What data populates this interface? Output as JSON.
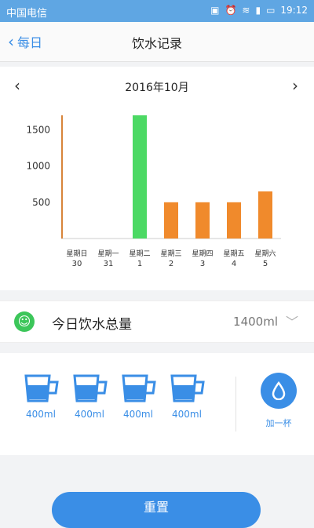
{
  "status_bar": {
    "carrier": "中国电信",
    "time": "19:12"
  },
  "nav": {
    "back_label": "每日",
    "title": "饮水记录"
  },
  "month": {
    "label": "2016年10月"
  },
  "chart_data": {
    "type": "bar",
    "categories": [
      "星期日 30",
      "星期一 31",
      "星期二 1",
      "星期三 2",
      "星期四 3",
      "星期五 4",
      "星期六 5"
    ],
    "day_names": [
      "星期日",
      "星期一",
      "星期二",
      "星期三",
      "星期四",
      "星期五",
      "星期六"
    ],
    "day_dates": [
      "30",
      "31",
      "1",
      "2",
      "3",
      "4",
      "5"
    ],
    "values": [
      1700,
      0,
      1700,
      500,
      500,
      500,
      650
    ],
    "bar_colors": [
      "#d8843a",
      "#ffffff",
      "#4cd964",
      "#f08a2c",
      "#f08a2c",
      "#f08a2c",
      "#f08a2c"
    ],
    "y_ticks": [
      "500",
      "1000",
      "1500"
    ],
    "y_tick_values": [
      500,
      1000,
      1500
    ],
    "ylim": [
      0,
      1700
    ],
    "grid": false
  },
  "total": {
    "label": "今日饮水总量",
    "value": "1400ml"
  },
  "cups": [
    {
      "amount": "400ml"
    },
    {
      "amount": "400ml"
    },
    {
      "amount": "400ml"
    },
    {
      "amount": "400ml"
    }
  ],
  "add": {
    "label": "加一杯"
  },
  "reset": {
    "label": "重置"
  },
  "colors": {
    "accent": "#3a8ee6",
    "green": "#4cd964",
    "orange": "#f08a2c",
    "status_bar": "#5fa6e3"
  }
}
